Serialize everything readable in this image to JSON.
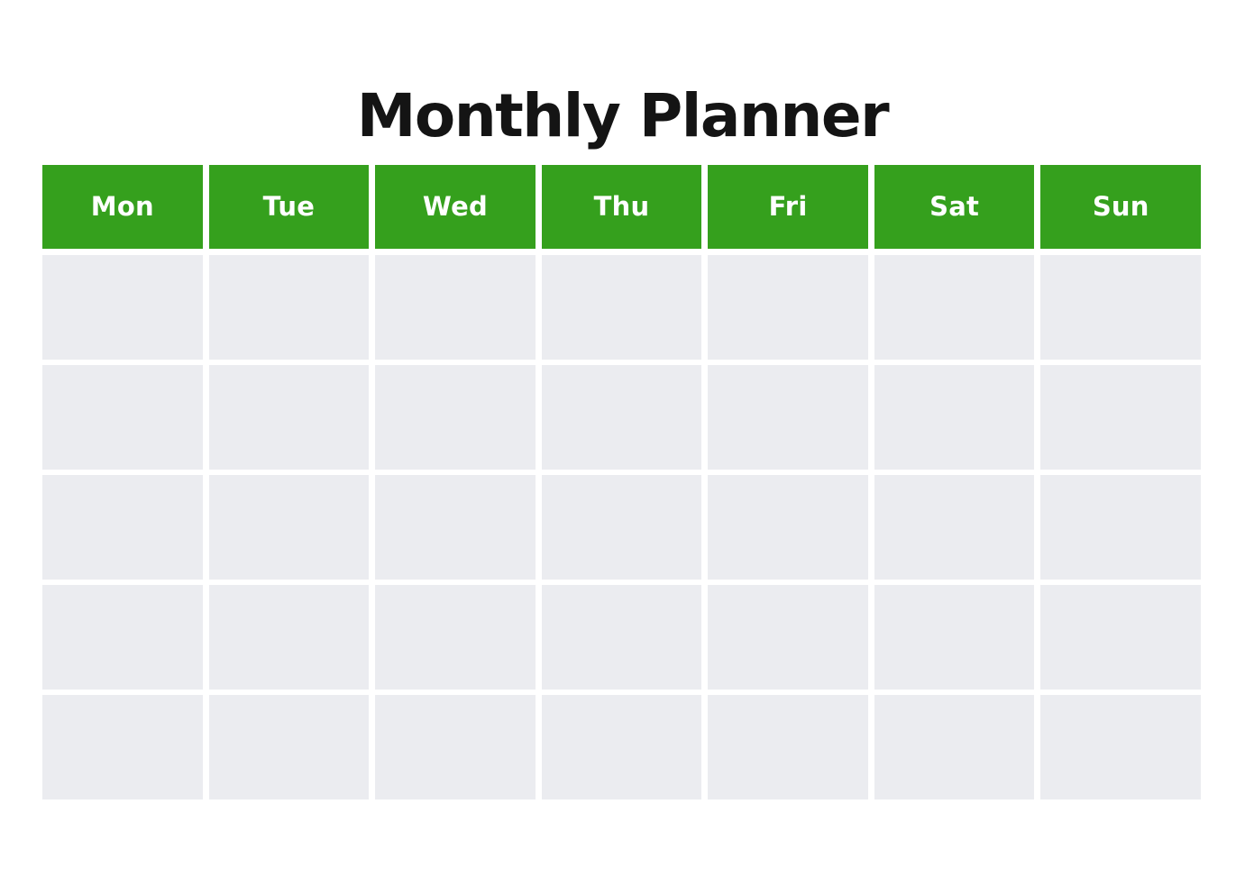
{
  "document": {
    "title": "Monthly Planner",
    "type": "monthly-calendar-planner",
    "colors": {
      "page_background": "#ffffff",
      "header_green": "#35a01d",
      "header_text": "#ffffff",
      "cell_fill": "#ebecf0",
      "title_text": "#141414"
    }
  },
  "calendar": {
    "weekday_headers": [
      {
        "label": "Mon"
      },
      {
        "label": "Tue"
      },
      {
        "label": "Wed"
      },
      {
        "label": "Thu"
      },
      {
        "label": "Fri"
      },
      {
        "label": "Sat"
      },
      {
        "label": "Sun"
      }
    ],
    "week_count": 5,
    "weeks": [
      {
        "days": [
          {
            "text": ""
          },
          {
            "text": ""
          },
          {
            "text": ""
          },
          {
            "text": ""
          },
          {
            "text": ""
          },
          {
            "text": ""
          },
          {
            "text": ""
          }
        ]
      },
      {
        "days": [
          {
            "text": ""
          },
          {
            "text": ""
          },
          {
            "text": ""
          },
          {
            "text": ""
          },
          {
            "text": ""
          },
          {
            "text": ""
          },
          {
            "text": ""
          }
        ]
      },
      {
        "days": [
          {
            "text": ""
          },
          {
            "text": ""
          },
          {
            "text": ""
          },
          {
            "text": ""
          },
          {
            "text": ""
          },
          {
            "text": ""
          },
          {
            "text": ""
          }
        ]
      },
      {
        "days": [
          {
            "text": ""
          },
          {
            "text": ""
          },
          {
            "text": ""
          },
          {
            "text": ""
          },
          {
            "text": ""
          },
          {
            "text": ""
          },
          {
            "text": ""
          }
        ]
      },
      {
        "days": [
          {
            "text": ""
          },
          {
            "text": ""
          },
          {
            "text": ""
          },
          {
            "text": ""
          },
          {
            "text": ""
          },
          {
            "text": ""
          },
          {
            "text": ""
          }
        ]
      }
    ]
  }
}
